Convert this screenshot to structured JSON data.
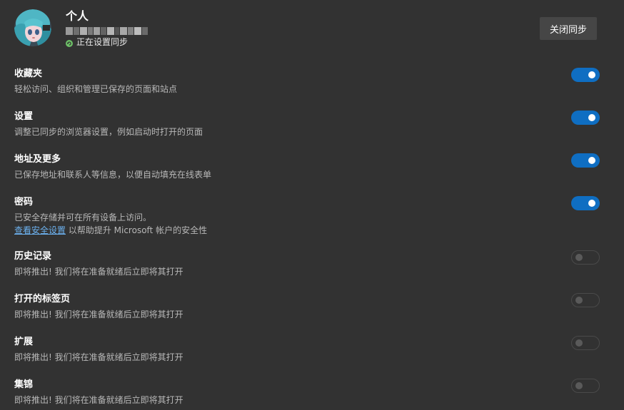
{
  "profile": {
    "name": "个人",
    "email_redacted": "",
    "sync_status": "正在设置同步"
  },
  "header": {
    "close_sync_label": "关闭同步"
  },
  "settings": [
    {
      "title": "收藏夹",
      "desc": "轻松访问、组织和管理已保存的页面和站点",
      "enabled": true
    },
    {
      "title": "设置",
      "desc": "调整已同步的浏览器设置，例如启动时打开的页面",
      "enabled": true
    },
    {
      "title": "地址及更多",
      "desc": "已保存地址和联系人等信息，以便自动填充在线表单",
      "enabled": true
    },
    {
      "title": "密码",
      "desc": "已安全存储并可在所有设备上访问。",
      "link": "查看安全设置",
      "link_suffix": " 以帮助提升 Microsoft 帐户的安全性",
      "enabled": true
    },
    {
      "title": "历史记录",
      "desc": "即将推出! 我们将在准备就绪后立即将其打开",
      "enabled": false
    },
    {
      "title": "打开的标签页",
      "desc": "即将推出! 我们将在准备就绪后立即将其打开",
      "enabled": false
    },
    {
      "title": "扩展",
      "desc": "即将推出! 我们将在准备就绪后立即将其打开",
      "enabled": false
    },
    {
      "title": "集锦",
      "desc": "即将推出! 我们将在准备就绪后立即将其打开",
      "enabled": false
    }
  ],
  "colors": {
    "background": "#323232",
    "toggle_on": "#0f6ec2",
    "link": "#6cb1ef",
    "sync_icon": "#6dbf67"
  },
  "icons": {
    "sync": "sync-status-icon",
    "avatar": "avatar"
  }
}
